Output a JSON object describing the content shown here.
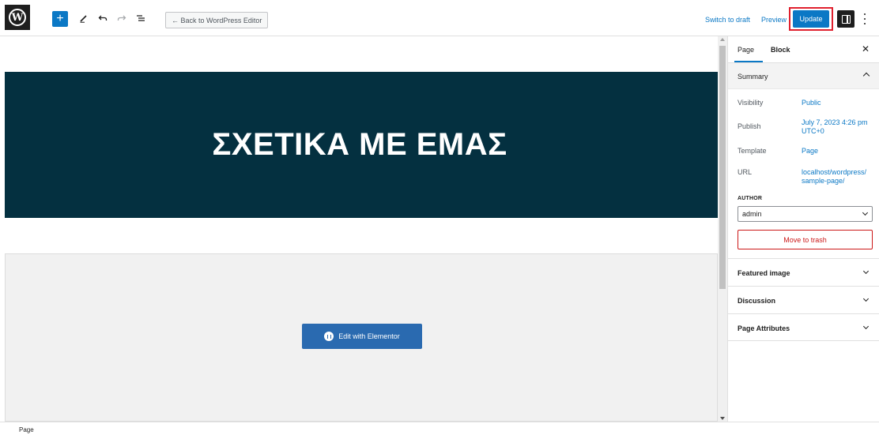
{
  "toolbar": {
    "logo_icon": "wordpress-logo-icon",
    "add_icon": "plus-icon",
    "tool_icon": "pencil-icon",
    "undo_icon": "undo-icon",
    "redo_icon": "redo-icon",
    "list_view_icon": "list-view-icon",
    "back_label": "← Back to WordPress Editor",
    "switch_draft_label": "Switch to draft",
    "preview_label": "Preview",
    "update_label": "Update",
    "settings_icon": "sidebar-toggle-icon",
    "more_icon": "more-options-icon"
  },
  "canvas": {
    "hero_title": "ΣΧΕΤΙΚΑ ΜΕ ΕΜΑΣ",
    "hero_bg_color": "#043040",
    "elementor_button_label": "Edit with Elementor",
    "elementor_icon": "elementor-icon"
  },
  "sidebar": {
    "tabs": [
      {
        "label": "Page"
      },
      {
        "label": "Block"
      }
    ],
    "close_icon": "close-icon",
    "summary": {
      "title": "Summary",
      "rows": [
        {
          "label": "Visibility",
          "value": "Public"
        },
        {
          "label": "Publish",
          "value": "July 7, 2023 4:26 pm UTC+0"
        },
        {
          "label": "Template",
          "value": "Page"
        },
        {
          "label": "URL",
          "value": "localhost/wordpress/ sample-page/"
        }
      ],
      "author_label": "AUTHOR",
      "author_value": "admin",
      "trash_label": "Move to trash"
    },
    "panels": [
      {
        "label": "Featured image"
      },
      {
        "label": "Discussion"
      },
      {
        "label": "Page Attributes"
      }
    ]
  },
  "footer": {
    "breadcrumb": "Page"
  },
  "colors": {
    "accent": "#0b78c5",
    "danger": "#cc1818",
    "highlight": "#e0202e"
  }
}
